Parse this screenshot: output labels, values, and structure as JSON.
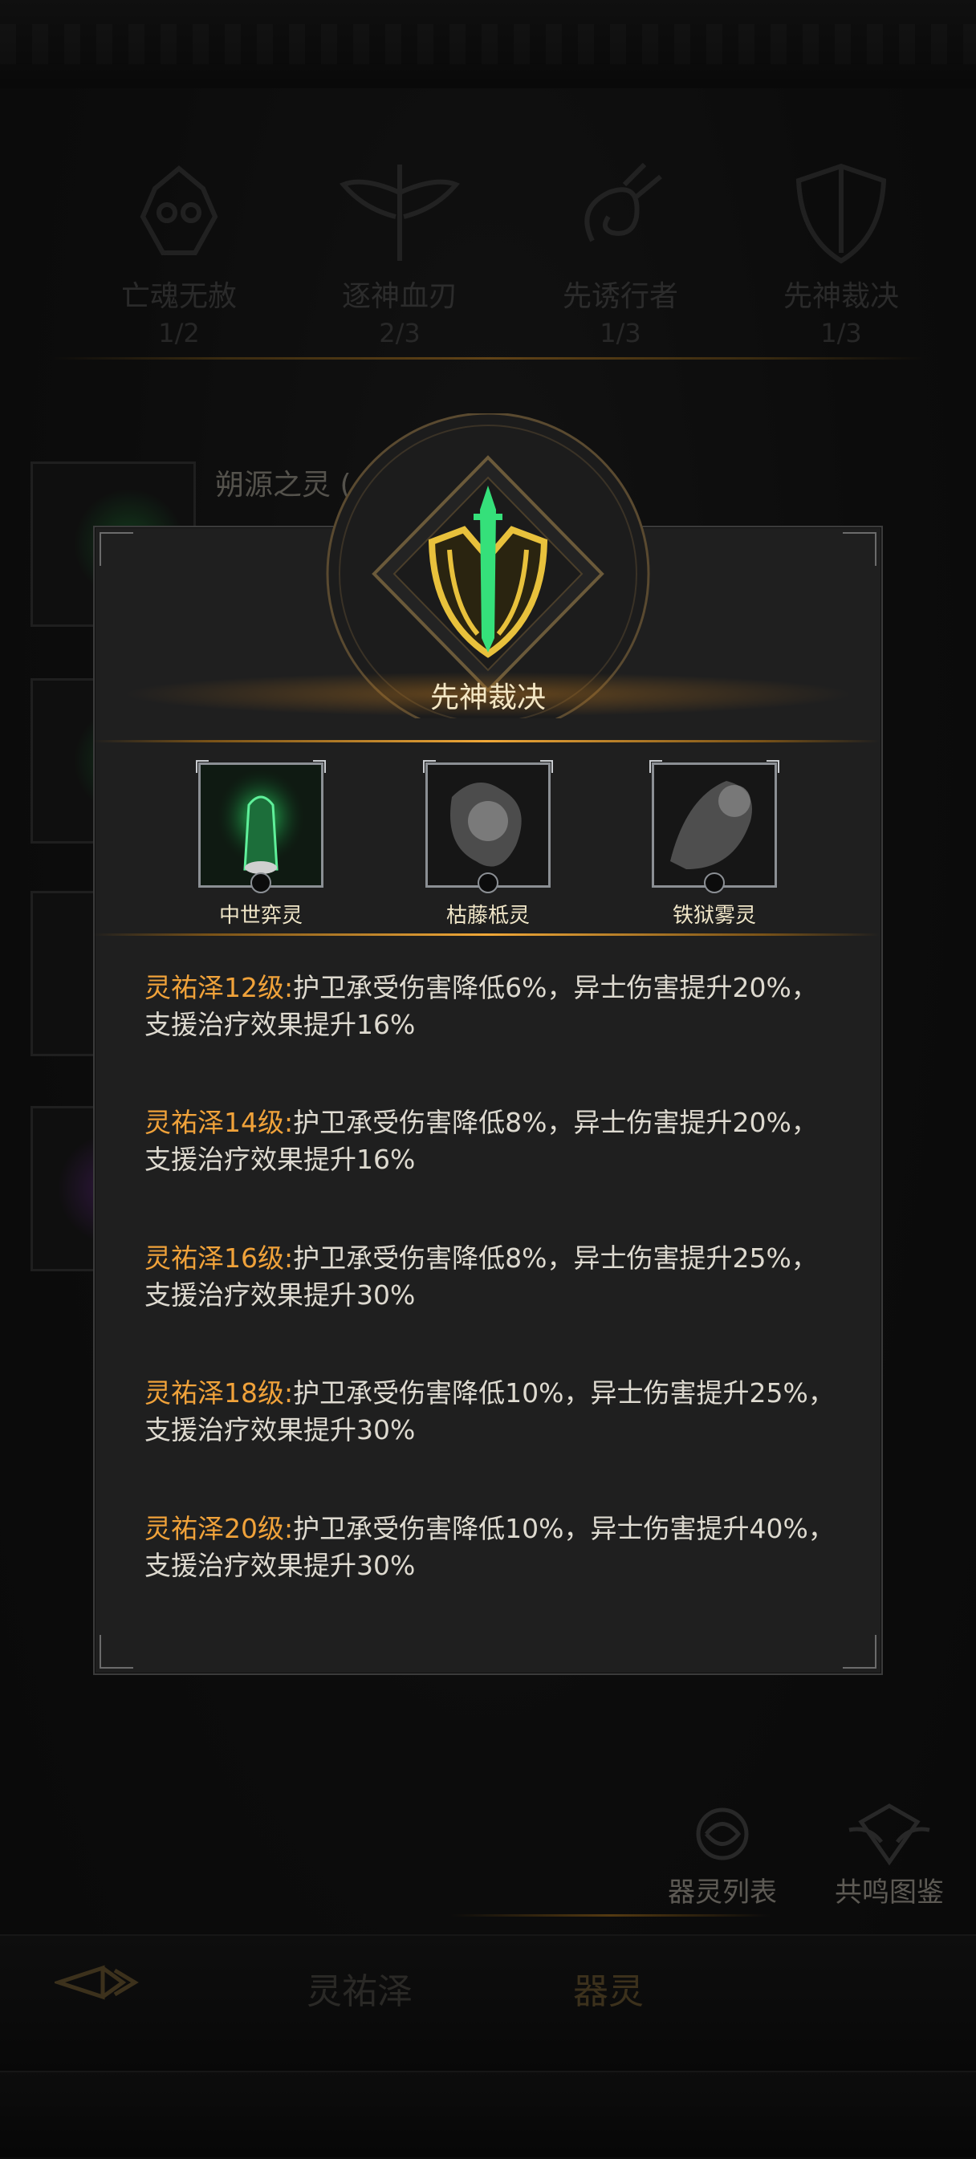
{
  "factions": [
    {
      "name": "亡魂无赦",
      "progress": "1/2"
    },
    {
      "name": "逐神血刃",
      "progress": "2/3"
    },
    {
      "name": "先诱行者",
      "progress": "1/3"
    },
    {
      "name": "先神裁决",
      "progress": "1/3"
    }
  ],
  "background_entry_title": "朔源之灵 (",
  "bottom_buttons": {
    "spirit_list": "器灵列表",
    "resonance_atlas": "共鸣图鉴"
  },
  "bottom_nav": {
    "tab1": "灵祐泽",
    "tab2": "器灵"
  },
  "modal": {
    "title": "先神裁决",
    "spirits": [
      {
        "name": "中世弈灵",
        "glow": "#2ee06a"
      },
      {
        "name": "枯藤柢灵",
        "glow": "#8a8a8a"
      },
      {
        "name": "铁狱雾灵",
        "glow": "#9a9a9a"
      }
    ],
    "bonuses": [
      {
        "level": "灵祐泽12级:",
        "text": "护卫承受伤害降低6%，异士伤害提升20%，支援治疗效果提升16%"
      },
      {
        "level": "灵祐泽14级:",
        "text": "护卫承受伤害降低8%，异士伤害提升20%，支援治疗效果提升16%"
      },
      {
        "level": "灵祐泽16级:",
        "text": "护卫承受伤害降低8%，异士伤害提升25%，支援治疗效果提升30%"
      },
      {
        "level": "灵祐泽18级:",
        "text": "护卫承受伤害降低10%，异士伤害提升25%，支援治疗效果提升30%"
      },
      {
        "level": "灵祐泽20级:",
        "text": "护卫承受伤害降低10%，异士伤害提升40%，支援治疗效果提升30%"
      }
    ]
  },
  "colors": {
    "accent_gold": "#f0a23a",
    "emblem_gold": "#e8c13c",
    "emblem_green": "#35e07a"
  }
}
